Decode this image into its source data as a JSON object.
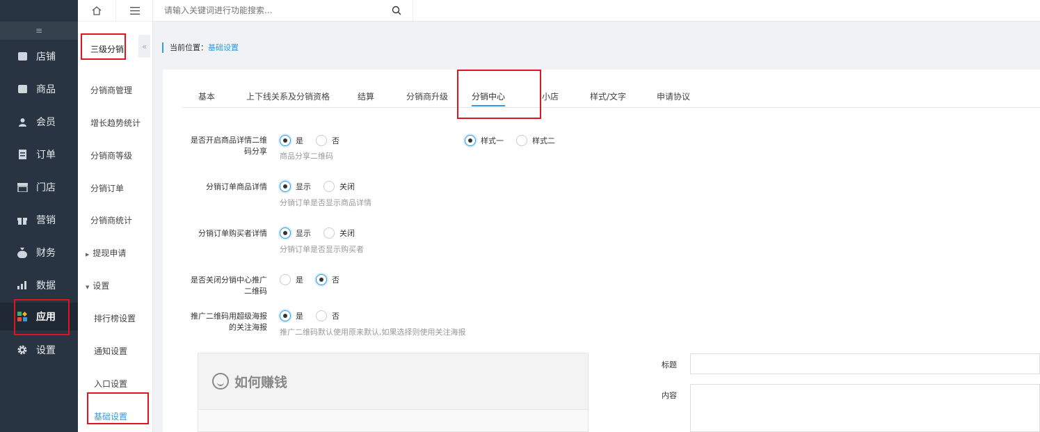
{
  "topbar": {
    "search_placeholder": "请输入关键词进行功能搜索..."
  },
  "nav": {
    "items": [
      {
        "label": "店铺",
        "icon": "store-icon"
      },
      {
        "label": "商品",
        "icon": "goods-icon"
      },
      {
        "label": "会员",
        "icon": "member-icon"
      },
      {
        "label": "订单",
        "icon": "order-icon"
      },
      {
        "label": "门店",
        "icon": "shop-icon"
      },
      {
        "label": "营销",
        "icon": "gift-icon"
      },
      {
        "label": "财务",
        "icon": "money-bag-icon"
      },
      {
        "label": "数据",
        "icon": "chart-icon"
      },
      {
        "label": "应用",
        "icon": "apps-icon"
      },
      {
        "label": "设置",
        "icon": "gear-icon"
      }
    ],
    "active": "应用"
  },
  "sub": {
    "title": "三级分销",
    "items": [
      "分销商管理",
      "增长趋势统计",
      "分销商等级",
      "分销订单",
      "分销商统计"
    ],
    "withdraw": "提现申请",
    "settings": "设置",
    "settings_children": [
      "排行榜设置",
      "通知设置",
      "入口设置",
      "基础设置"
    ],
    "active": "基础设置"
  },
  "breadcrumb": {
    "prefix": "当前位置：",
    "current": "基础设置"
  },
  "tabs": [
    "基本",
    "上下线关系及分销资格",
    "结算",
    "分销商升级",
    "分销中心",
    "小店",
    "样式/文字",
    "申请协议"
  ],
  "active_tab": "分销中心",
  "form": {
    "qr_share": {
      "label_line1": "是否开启商品详情二维",
      "label_line2": "码分享",
      "yes": "是",
      "no": "否",
      "hint": "商品分享二维码",
      "style1": "样式一",
      "style2": "样式二"
    },
    "order_goods": {
      "label": "分销订单商品详情",
      "show": "显示",
      "close": "关闭",
      "hint": "分销订单是否显示商品详情"
    },
    "order_buyer": {
      "label": "分销订单购买者详情",
      "show": "显示",
      "close": "关闭",
      "hint": "分销订单是否显示购买者"
    },
    "close_qr": {
      "label_line1": "是否关闭分销中心推广",
      "label_line2": "二维码",
      "yes": "是",
      "no": "否"
    },
    "super_poster": {
      "label_line1": "推广二维码用超级海报",
      "label_line2": "的关注海报",
      "yes": "是",
      "no": "否",
      "hint": "推广二维码默认使用原来默认,如果选择则使用关注海报"
    },
    "preview_title": "如何赚钱",
    "title_label": "标题",
    "content_label": "内容"
  }
}
